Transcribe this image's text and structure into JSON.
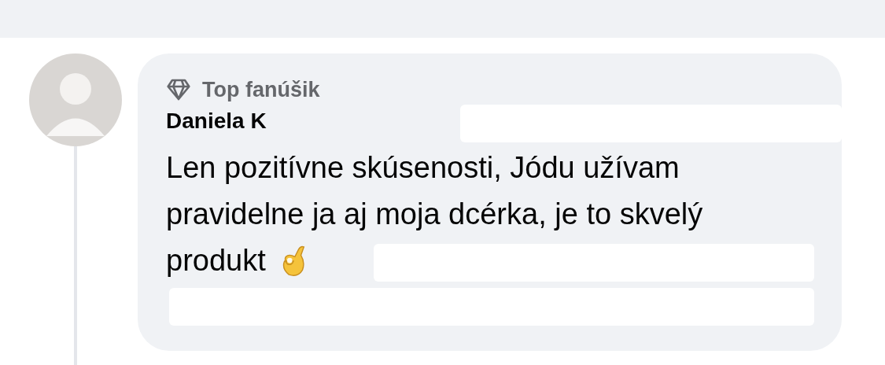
{
  "comment": {
    "badge": "Top fanúšik",
    "author": "Daniela K",
    "lines": [
      "Len pozitívne skúsenosti, Jódu užívam",
      "pravidelne ja aj moja dcérka, je to skvelý",
      "produkt"
    ]
  }
}
